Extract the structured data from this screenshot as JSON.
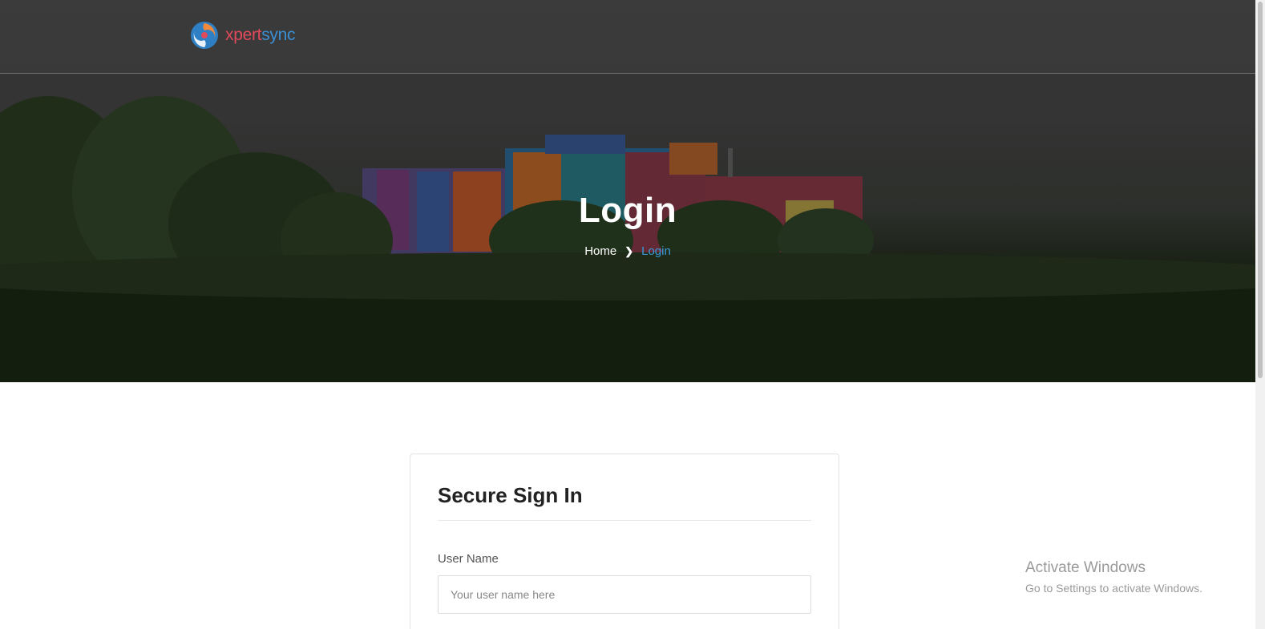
{
  "header": {
    "logo_text_part1": "xpert",
    "logo_text_part2": "sync",
    "icon": "swirl-logo-icon"
  },
  "hero": {
    "title": "Login",
    "breadcrumb": {
      "home": "Home",
      "separator_icon": "chevron-right-icon",
      "current": "Login"
    }
  },
  "card": {
    "title": "Secure Sign In",
    "username": {
      "label": "User Name",
      "placeholder": "Your user name here",
      "value": ""
    }
  },
  "watermark": {
    "title": "Activate Windows",
    "subtitle": "Go to Settings to activate Windows."
  },
  "colors": {
    "brand_red": "#e2495b",
    "brand_blue": "#3a8fd4",
    "breadcrumb_active": "#3a9ad9"
  }
}
